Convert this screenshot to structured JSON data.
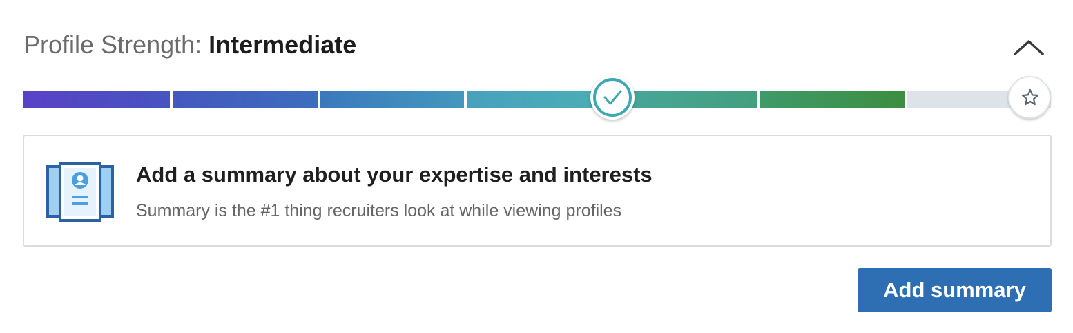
{
  "header": {
    "label": "Profile Strength:",
    "level": "Intermediate",
    "collapse_icon": "chevron-up-icon"
  },
  "meter": {
    "segments_total": 7,
    "current_segment": 4,
    "segment_colors": [
      "#5a42c6",
      "#4458bf",
      "#3b78bd",
      "#48a1bf",
      "#3f9a6a",
      "#3c8e40",
      "#dde3e8"
    ],
    "current_marker_icon": "check-icon",
    "goal_marker_icon": "star-icon"
  },
  "suggestion": {
    "icon": "profile-document-icon",
    "title": "Add a summary about your expertise and interests",
    "subtitle": "Summary is the #1 thing recruiters look at while viewing profiles"
  },
  "action": {
    "button_label": "Add summary",
    "button_color": "#2e6fb3"
  }
}
